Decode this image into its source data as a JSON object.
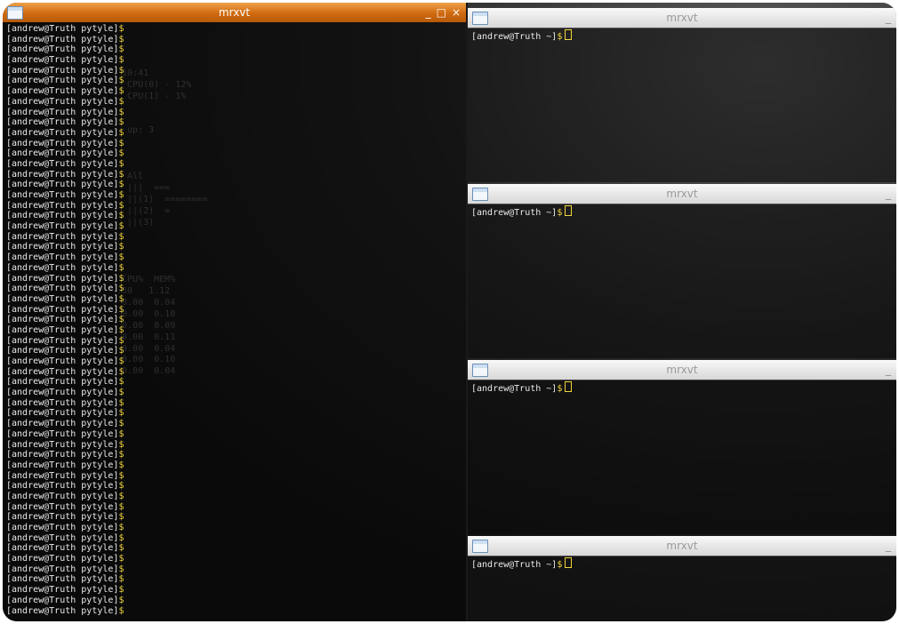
{
  "windows": {
    "main": {
      "title": "mrxvt",
      "minimize": "_",
      "maximize": "□",
      "close": "×",
      "prompt": "[andrew@Truth pytyle]",
      "dollar": "$",
      "line_count": 57
    },
    "right": [
      {
        "title": "mrxvt",
        "minimize": "_",
        "prompt": "[andrew@Truth ~]",
        "dollar": "$"
      },
      {
        "title": "mrxvt",
        "minimize": "_",
        "prompt": "[andrew@Truth ~]",
        "dollar": "$"
      },
      {
        "title": "mrxvt",
        "minimize": "_",
        "prompt": "[andrew@Truth ~]",
        "dollar": "$"
      },
      {
        "title": "mrxvt",
        "minimize": "_",
        "prompt": "[andrew@Truth ~]",
        "dollar": "$"
      }
    ]
  },
  "background_ghost_text": [
    "",
    "",
    " 10:41",
    "  CPU(0) - 12%",
    "  CPU(1) - 1%",
    "",
    "",
    "  up: 3",
    "",
    "",
    "",
    "  All",
    "  |||  ===",
    "  ||(1)  ========",
    "  ||(2)  =",
    "  ||(3)",
    "",
    "",
    "",
    "",
    " CPU%  MEM%",
    ".50   1.12",
    " 0.00  0.04",
    " 0.00  0.10",
    " 0.00  0.09",
    " 0.00  0.11",
    " 0.00  0.04",
    " 0.00  0.10",
    " 0.00  0.04"
  ]
}
